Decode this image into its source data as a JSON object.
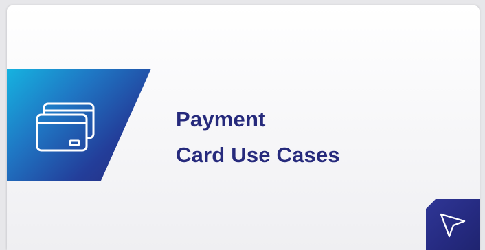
{
  "card": {
    "title_line1": "Payment",
    "title_line2": "Card Use Cases",
    "icon": "credit-card-icon",
    "cta_icon": "cursor-arrow-icon"
  },
  "colors": {
    "title": "#262a7c",
    "banner_start": "#16b3e0",
    "banner_end": "#262a7a",
    "cta": "#2a2f8a"
  }
}
